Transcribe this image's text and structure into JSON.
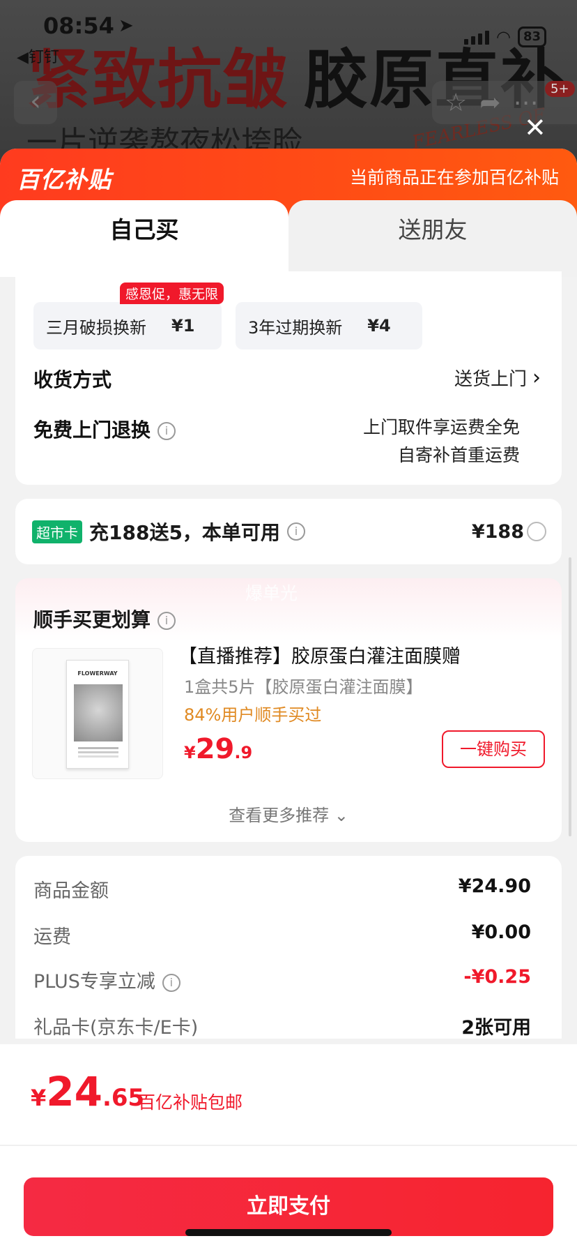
{
  "status_bar": {
    "time": "08:54",
    "back_app": "◀钉钉",
    "battery": "83"
  },
  "background": {
    "headline_red": "紧致抗皱",
    "headline_black": "胶原直补",
    "subline": "一片逆袭熬夜松垮脸",
    "script_text": "FEARLESS OF",
    "cart_badge": "5+"
  },
  "banner": {
    "logo": "百亿补贴",
    "text": "当前商品正在参加百亿补贴"
  },
  "tabs": [
    {
      "label": "自己买",
      "active": true
    },
    {
      "label": "送朋友",
      "active": false
    }
  ],
  "service_options": [
    {
      "label": "三月破损换新",
      "price": "¥1"
    },
    {
      "label": "3年过期换新",
      "price": "¥4"
    }
  ],
  "promo_tag": "感恩促，惠无限",
  "delivery": {
    "label": "收货方式",
    "value": "送货上门"
  },
  "free_return": {
    "label": "免费上门退换",
    "line1": "上门取件享运费全免",
    "line2": "自寄补首重运费"
  },
  "supermarket_card": {
    "badge": "超市卡",
    "text": "充188送5，本单可用",
    "price": "¥188"
  },
  "recommend": {
    "watermark": "爆单光",
    "title": "顺手买更划算",
    "product": {
      "brand": "FLOWERWAY",
      "name": "【直播推荐】胶原蛋白灌注面膜赠",
      "desc": "1盒共5片【胶原蛋白灌注面膜】",
      "hint": "84%用户顺手买过",
      "price_symbol": "¥",
      "price_int": "29",
      "price_dec": ".9",
      "button": "一键购买"
    },
    "more": "查看更多推荐 ⌄"
  },
  "summary": [
    {
      "label": "商品金额",
      "value": "¥24.90",
      "red": false
    },
    {
      "label": "运费",
      "value": "¥0.00",
      "red": false
    },
    {
      "label": "PLUS专享立减",
      "value": "-¥0.25",
      "red": true
    },
    {
      "label": "礼品卡(京东卡/E卡)",
      "value": "2张可用",
      "red": false
    }
  ],
  "footer": {
    "total_symbol": "¥",
    "total_int": "24",
    "total_dec": ".65",
    "note": "百亿补贴包邮",
    "pay_button": "立即支付"
  },
  "colors": {
    "accent_red": "#f0192b",
    "banner_orange": "#ff4a16",
    "card_green": "#10b26b"
  }
}
